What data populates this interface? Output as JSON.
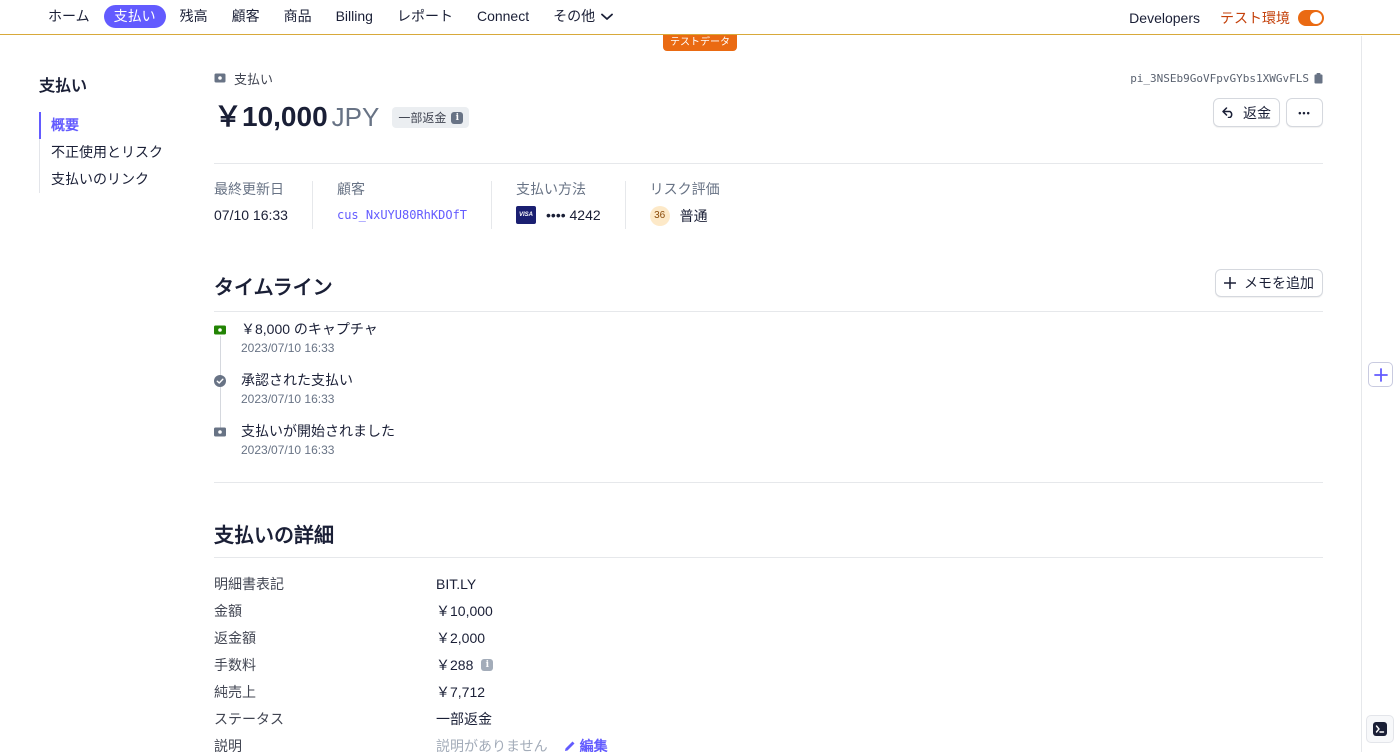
{
  "nav": {
    "items": [
      {
        "label": "ホーム",
        "active": false
      },
      {
        "label": "支払い",
        "active": true
      },
      {
        "label": "残高",
        "active": false
      },
      {
        "label": "顧客",
        "active": false
      },
      {
        "label": "商品",
        "active": false
      },
      {
        "label": "Billing",
        "active": false
      },
      {
        "label": "レポート",
        "active": false
      },
      {
        "label": "Connect",
        "active": false
      }
    ],
    "more_label": "その他",
    "developers_label": "Developers",
    "test_env_label": "テスト環境",
    "test_data_badge": "テストデータ"
  },
  "sidebar": {
    "title": "支払い",
    "items": [
      {
        "label": "概要",
        "active": true
      },
      {
        "label": "不正使用とリスク",
        "active": false
      },
      {
        "label": "支払いのリンク",
        "active": false
      }
    ]
  },
  "header": {
    "breadcrumb": "支払い",
    "payment_id": "pi_3NSEb9GoVFpvGYbs1XWGvFLS",
    "amount": "￥10,000",
    "currency": "JPY",
    "status_badge": "一部返金",
    "refund_button": "返金",
    "more_button": "•••"
  },
  "summary": {
    "last_updated_label": "最終更新日",
    "last_updated_value": "07/10 16:33",
    "customer_label": "顧客",
    "customer_value": "cus_NxUYU80RhKDOfT",
    "payment_method_label": "支払い方法",
    "card_brand": "VISA",
    "card_last4": "•••• 4242",
    "risk_label": "リスク評価",
    "risk_score": "36",
    "risk_value": "普通"
  },
  "timeline": {
    "title": "タイムライン",
    "add_memo_button": "メモを追加",
    "events": [
      {
        "title": "￥8,000 のキャプチャ",
        "date": "2023/07/10 16:33",
        "icon": "capture-icon"
      },
      {
        "title": "承認された支払い",
        "date": "2023/07/10 16:33",
        "icon": "check-circle-icon"
      },
      {
        "title": "支払いが開始されました",
        "date": "2023/07/10 16:33",
        "icon": "payment-icon"
      }
    ]
  },
  "details": {
    "title": "支払いの詳細",
    "rows": [
      {
        "label": "明細書表記",
        "value": "BIT.LY"
      },
      {
        "label": "金額",
        "value": "￥10,000"
      },
      {
        "label": "返金額",
        "value": "￥2,000"
      },
      {
        "label": "手数料",
        "value": "￥288"
      },
      {
        "label": "純売上",
        "value": "￥7,712"
      },
      {
        "label": "ステータス",
        "value": "一部返金"
      },
      {
        "label": "説明",
        "value": "説明がありません"
      }
    ],
    "edit_label": "編集"
  },
  "colors": {
    "accent": "#635bff",
    "test_orange": "#ea6a12"
  }
}
